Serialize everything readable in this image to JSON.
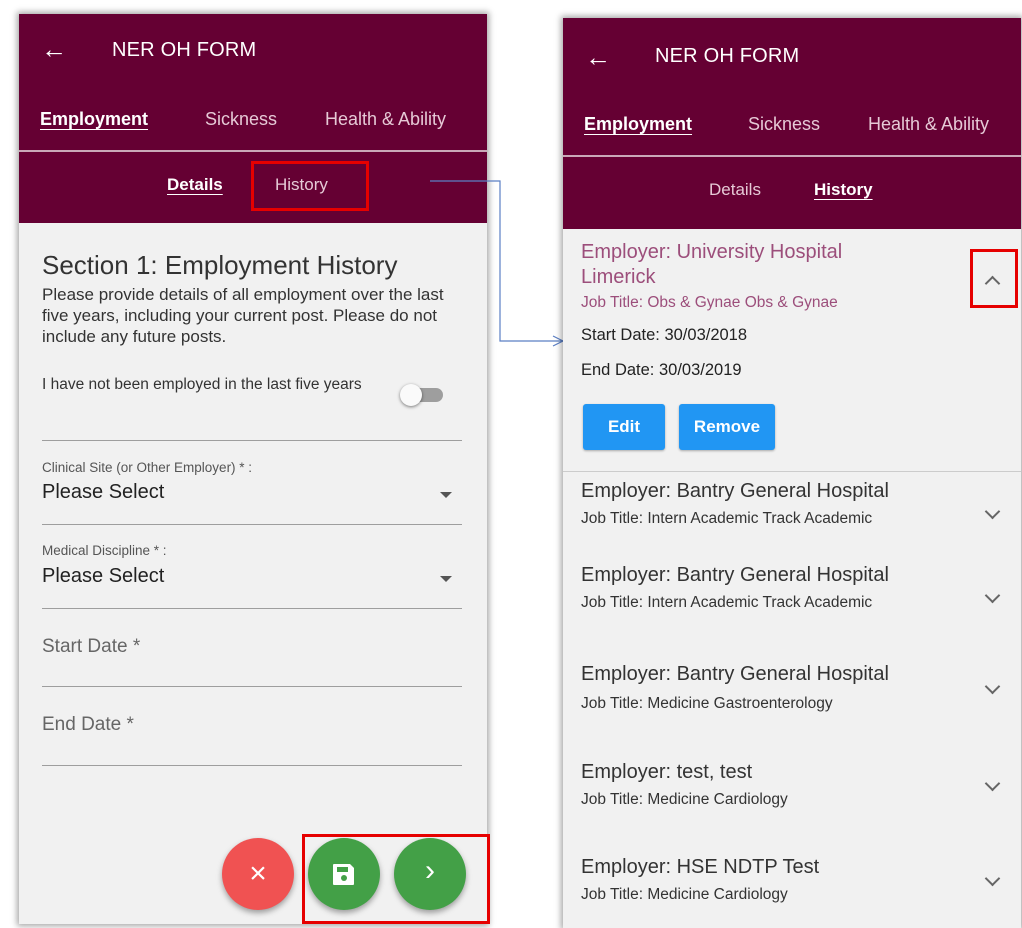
{
  "header": {
    "title": "NER OH FORM",
    "back_icon": "arrow-left-icon",
    "tabs": [
      "Employment",
      "Sickness",
      "Health & Ability"
    ],
    "active_tab": "Employment",
    "subtabs": [
      "Details",
      "History"
    ],
    "brand_color": "#650033"
  },
  "left": {
    "active_subtab": "Details",
    "section_title": "Section 1: Employment History",
    "section_description": "Please provide details of all employment over the last five years, including your current post. Please do not include any future posts.",
    "toggle_label": "I have not been employed in the last five years",
    "toggle_on": false,
    "fields": {
      "clinical_site": {
        "label": "Clinical Site (or Other Employer) * :",
        "value": "Please Select"
      },
      "medical_discipline": {
        "label": "Medical Discipline * :",
        "value": "Please Select"
      },
      "start_date": {
        "placeholder": "Start Date *"
      },
      "end_date": {
        "placeholder": "End Date *"
      }
    },
    "fab": {
      "cancel": {
        "glyph": "×",
        "color": "#f05252"
      },
      "save": {
        "icon": "floppy-disk-icon",
        "color": "#43a047"
      },
      "next": {
        "glyph": "›",
        "color": "#43a047"
      }
    }
  },
  "right": {
    "active_subtab": "History",
    "expanded_item": {
      "employer": "Employer: University Hospital Limerick",
      "job_title": "Job Title: Obs & Gynae Obs & Gynae",
      "start_date": "Start Date: 30/03/2018",
      "end_date": "End Date: 30/03/2019",
      "edit_label": "Edit",
      "remove_label": "Remove",
      "accent": "#9c4e7b",
      "button_color": "#2196f3"
    },
    "items": [
      {
        "employer": "Employer: Bantry General Hospital",
        "job_title": "Job Title: Intern Academic Track Academic"
      },
      {
        "employer": "Employer: Bantry General Hospital",
        "job_title": "Job Title: Intern Academic Track Academic"
      },
      {
        "employer": "Employer: Bantry General Hospital",
        "job_title": "Job Title: Medicine Gastroenterology"
      },
      {
        "employer": "Employer: test, test",
        "job_title": "Job Title: Medicine Cardiology"
      },
      {
        "employer": "Employer: HSE NDTP Test",
        "job_title": "Job Title: Medicine Cardiology"
      }
    ]
  }
}
